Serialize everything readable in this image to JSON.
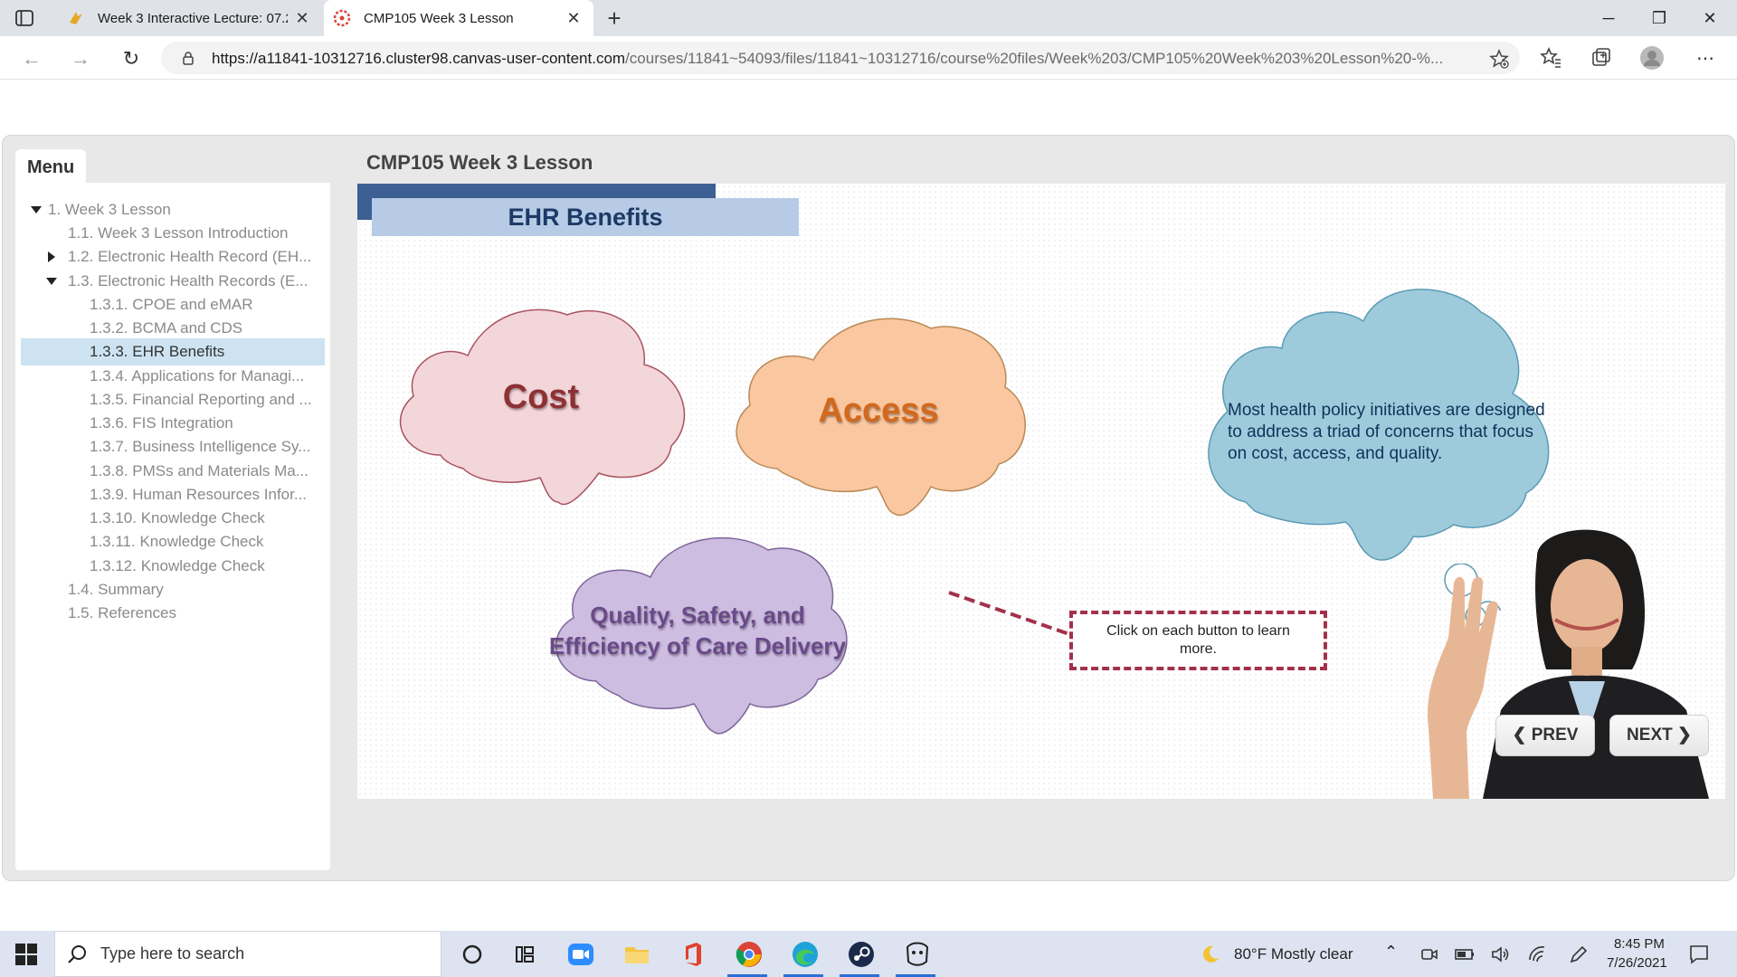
{
  "browser": {
    "tabs": [
      {
        "label": "Week 3 Interactive Lecture: 07.2",
        "active": false
      },
      {
        "label": "CMP105 Week 3 Lesson",
        "active": true
      }
    ],
    "url_host": "https://a11841-10312716.cluster98.canvas-user-content.com",
    "url_path": "/courses/11841~54093/files/11841~10312716/course%20files/Week%203/CMP105%20Week%203%20Lesson%20-%..."
  },
  "app": {
    "menu_label": "Menu",
    "lesson_title": "CMP105 Week 3 Lesson",
    "nav": [
      {
        "label": "1. Week 3 Lesson",
        "caret": "down",
        "level": 0
      },
      {
        "label": "1.1. Week 3 Lesson Introduction",
        "caret": "",
        "level": 1
      },
      {
        "label": "1.2. Electronic Health Record (EH...",
        "caret": "right",
        "level": 1
      },
      {
        "label": "1.3. Electronic Health Records (E...",
        "caret": "down",
        "level": 1
      },
      {
        "label": "1.3.1. CPOE and eMAR",
        "caret": "",
        "level": 2
      },
      {
        "label": "1.3.2. BCMA and CDS",
        "caret": "",
        "level": 2
      },
      {
        "label": "1.3.3. EHR Benefits",
        "caret": "",
        "level": 2,
        "selected": true
      },
      {
        "label": "1.3.4. Applications for Managi...",
        "caret": "",
        "level": 2
      },
      {
        "label": "1.3.5. Financial Reporting and ...",
        "caret": "",
        "level": 2
      },
      {
        "label": "1.3.6. FIS Integration",
        "caret": "",
        "level": 2
      },
      {
        "label": "1.3.7. Business Intelligence Sy...",
        "caret": "",
        "level": 2
      },
      {
        "label": "1.3.8. PMSs and Materials Ma...",
        "caret": "",
        "level": 2
      },
      {
        "label": "1.3.9. Human Resources Infor...",
        "caret": "",
        "level": 2
      },
      {
        "label": "1.3.10. Knowledge Check",
        "caret": "",
        "level": 2
      },
      {
        "label": "1.3.11. Knowledge Check",
        "caret": "",
        "level": 2
      },
      {
        "label": "1.3.12. Knowledge Check",
        "caret": "",
        "level": 2
      },
      {
        "label": "1.4. Summary",
        "caret": "",
        "level": 1
      },
      {
        "label": "1.5. References",
        "caret": "",
        "level": 1
      }
    ],
    "slide": {
      "header": "EHR Benefits",
      "clouds": {
        "cost": "Cost",
        "access": "Access",
        "quality_line1": "Quality, Safety, and",
        "quality_line2": "Efficiency of Care Delivery"
      },
      "info": "Most health policy initiatives are designed to address a triad of concerns that focus on cost, access, and quality.",
      "hint": "Click on each button to learn more."
    },
    "buttons": {
      "prev": "PREV",
      "next": "NEXT"
    }
  },
  "taskbar": {
    "search_placeholder": "Type here to search",
    "weather": "80°F  Mostly clear",
    "time": "8:45 PM",
    "date": "7/26/2021"
  },
  "colors": {
    "accent_blue": "#3d5f93",
    "header_bg": "#b7cbe6",
    "cost_cloud": "#f2d3d6",
    "access_cloud": "#f9c9a1",
    "quality_cloud": "#cbbbe0",
    "info_cloud": "#9ecbdc",
    "hint_border": "#a3314b"
  }
}
